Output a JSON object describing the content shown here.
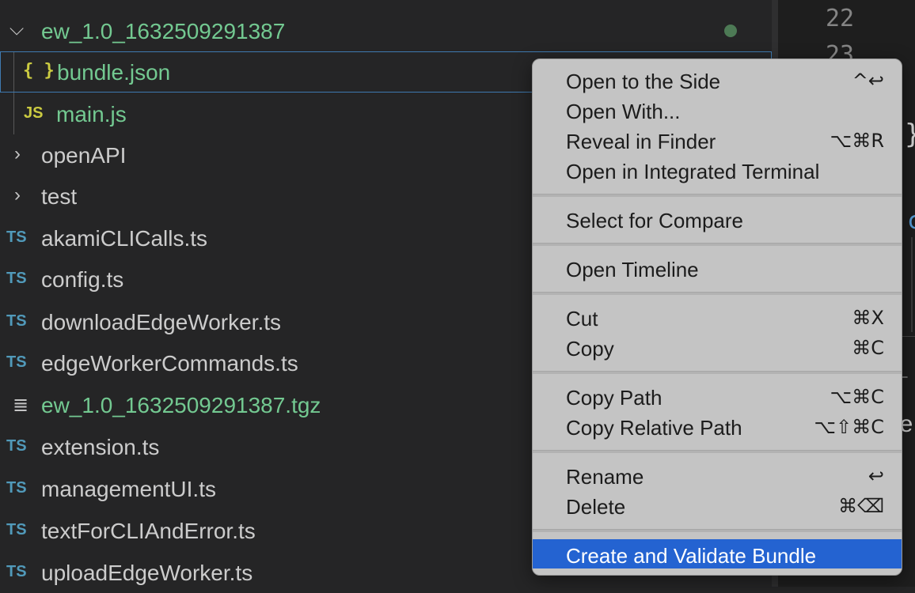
{
  "tree": {
    "root_folder": {
      "label": "ew_1.0_1632509291387",
      "icon": "chevron-down-icon"
    },
    "root_children": [
      {
        "label": "bundle.json",
        "icon": "{ }",
        "icon_name": "json-file-icon"
      },
      {
        "label": "main.js",
        "icon": "JS",
        "icon_name": "js-file-icon"
      }
    ],
    "folders": [
      {
        "label": "openAPI",
        "icon": "chevron-right-icon"
      },
      {
        "label": "test",
        "icon": "chevron-right-icon"
      }
    ],
    "files": [
      {
        "label": "akamiCLICalls.ts",
        "icon": "TS"
      },
      {
        "label": "config.ts",
        "icon": "TS"
      },
      {
        "label": "downloadEdgeWorker.ts",
        "icon": "TS"
      },
      {
        "label": "edgeWorkerCommands.ts",
        "icon": "TS"
      },
      {
        "label": "ew_1.0_1632509291387.tgz",
        "icon": "lines"
      },
      {
        "label": "extension.ts",
        "icon": "TS"
      },
      {
        "label": "managementUI.ts",
        "icon": "TS"
      },
      {
        "label": "textForCLIAndError.ts",
        "icon": "TS"
      },
      {
        "label": "uploadEdgeWorker.ts",
        "icon": "TS"
      }
    ]
  },
  "editor": {
    "line_numbers": [
      "22",
      "23"
    ],
    "fragments": {
      "brace": "}",
      "c": "c",
      "l": "L",
      "le": "le"
    }
  },
  "context_menu": {
    "groups": [
      [
        {
          "label": "Open to the Side",
          "shortcut": "^↩"
        },
        {
          "label": "Open With...",
          "shortcut": ""
        },
        {
          "label": "Reveal in Finder",
          "shortcut": "⌥⌘R"
        },
        {
          "label": "Open in Integrated Terminal",
          "shortcut": ""
        }
      ],
      [
        {
          "label": "Select for Compare",
          "shortcut": ""
        }
      ],
      [
        {
          "label": "Open Timeline",
          "shortcut": ""
        }
      ],
      [
        {
          "label": "Cut",
          "shortcut": "⌘X"
        },
        {
          "label": "Copy",
          "shortcut": "⌘C"
        }
      ],
      [
        {
          "label": "Copy Path",
          "shortcut": "⌥⌘C"
        },
        {
          "label": "Copy Relative Path",
          "shortcut": "⌥⇧⌘C"
        }
      ],
      [
        {
          "label": "Rename",
          "shortcut": "↩"
        },
        {
          "label": "Delete",
          "shortcut": "⌘⌫"
        }
      ],
      [
        {
          "label": "Create and Validate Bundle",
          "shortcut": "",
          "highlighted": true
        }
      ]
    ]
  },
  "colors": {
    "background": "#252526",
    "git_added_green": "#73c991",
    "menu_background": "#c4c4c4",
    "menu_highlight": "#2463d1",
    "ts_icon": "#519aba",
    "js_icon": "#cbcb41"
  }
}
